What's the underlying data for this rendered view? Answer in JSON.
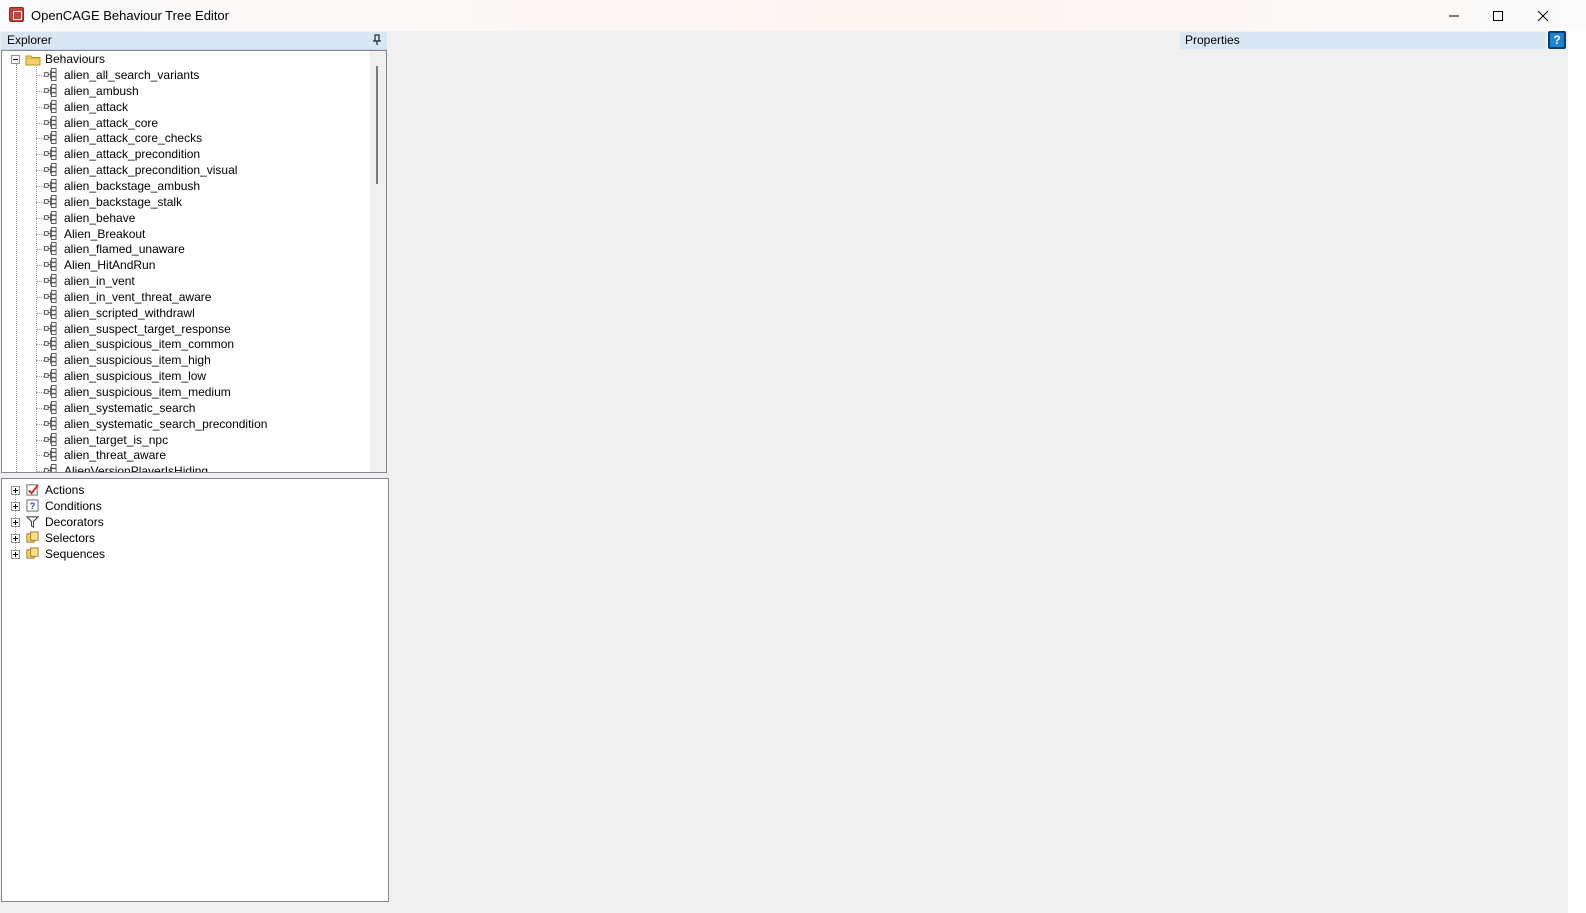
{
  "window": {
    "title": "OpenCAGE Behaviour Tree Editor"
  },
  "explorer": {
    "title": "Explorer",
    "root": "Behaviours",
    "behaviours": [
      "alien_all_search_variants",
      "alien_ambush",
      "alien_attack",
      "alien_attack_core",
      "alien_attack_core_checks",
      "alien_attack_precondition",
      "alien_attack_precondition_visual",
      "alien_backstage_ambush",
      "alien_backstage_stalk",
      "alien_behave",
      "Alien_Breakout",
      "alien_flamed_unaware",
      "Alien_HitAndRun",
      "alien_in_vent",
      "alien_in_vent_threat_aware",
      "alien_scripted_withdrawl",
      "alien_suspect_target_response",
      "alien_suspicious_item_common",
      "alien_suspicious_item_high",
      "alien_suspicious_item_low",
      "alien_suspicious_item_medium",
      "alien_systematic_search",
      "alien_systematic_search_precondition",
      "alien_target_is_npc",
      "alien_threat_aware",
      "AlienVersionPlayerIsHiding"
    ]
  },
  "toolbox": {
    "categories": [
      {
        "label": "Actions",
        "icon": "actions-icon"
      },
      {
        "label": "Conditions",
        "icon": "conditions-icon"
      },
      {
        "label": "Decorators",
        "icon": "decorators-icon"
      },
      {
        "label": "Selectors",
        "icon": "selectors-icon"
      },
      {
        "label": "Sequences",
        "icon": "sequences-icon"
      }
    ]
  },
  "properties": {
    "title": "Properties",
    "help_icon": "?"
  },
  "colors": {
    "pane_header": "#d9e7f4",
    "background": "#f0f0f0",
    "help_blue": "#1a83d6"
  }
}
